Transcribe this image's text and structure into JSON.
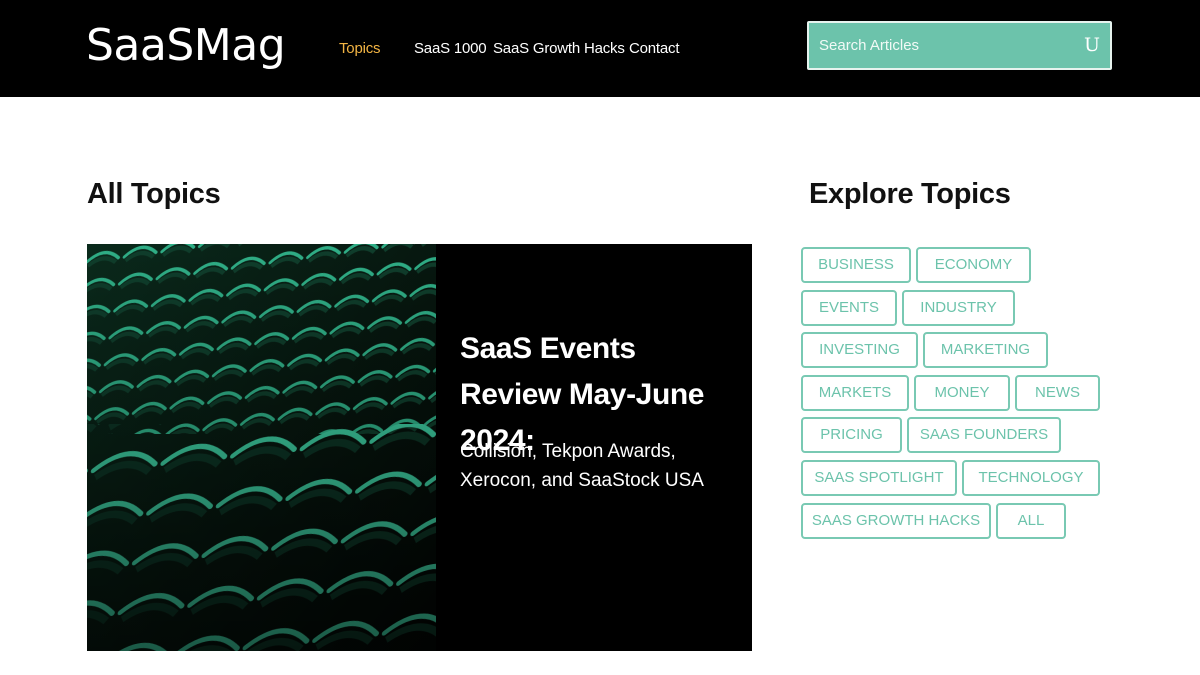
{
  "header": {
    "logo": "SaaSMag",
    "nav": [
      {
        "label": "Topics",
        "active": true
      },
      {
        "label": "SaaS 1000",
        "active": false
      },
      {
        "label": "SaaS Growth Hacks",
        "active": false
      },
      {
        "label": "Contact",
        "active": false
      }
    ],
    "search": {
      "placeholder": "Search Articles",
      "icon": "search-icon"
    }
  },
  "main": {
    "heading": "All Topics",
    "featured": {
      "title": "SaaS Events Review May-June 2024:",
      "subtitle": "Collision, Tekpon Awards, Xerocon, and SaaStock USA",
      "image": "stadium-seats-green"
    }
  },
  "sidebar": {
    "heading": "Explore Topics",
    "tags": [
      "BUSINESS",
      "ECONOMY",
      "EVENTS",
      "INDUSTRY",
      "INVESTING",
      "MARKETING",
      "MARKETS",
      "MONEY",
      "NEWS",
      "PRICING",
      "SAAS FOUNDERS",
      "SAAS SPOTLIGHT",
      "TECHNOLOGY",
      "SAAS GROWTH HACKS",
      "ALL"
    ]
  },
  "colors": {
    "header_bg": "#000000",
    "accent": "#6cc3ab",
    "nav_active": "#f2b443",
    "tag_border": "#79c9b3"
  }
}
